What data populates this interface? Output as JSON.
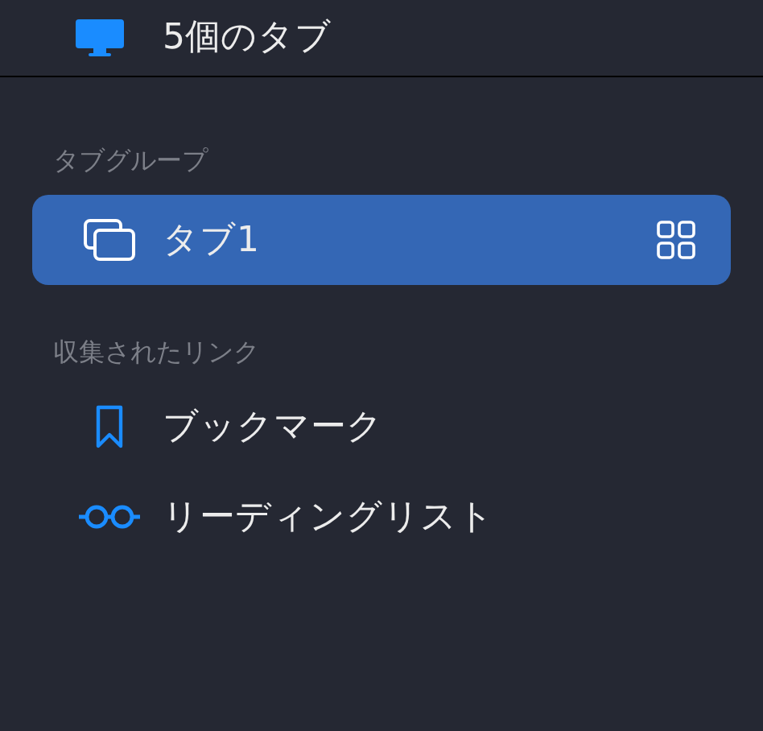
{
  "top_item": {
    "label": "5個のタブ",
    "kind": "device"
  },
  "sections": [
    {
      "header": "タブグループ",
      "items": [
        {
          "label": "タブ1",
          "kind": "tab-group",
          "selected": true,
          "overview_button": true
        }
      ]
    },
    {
      "header": "収集されたリンク",
      "items": [
        {
          "label": "ブックマーク",
          "kind": "bookmark",
          "selected": false,
          "overview_button": false
        },
        {
          "label": "リーディングリスト",
          "kind": "reading-list",
          "selected": false,
          "overview_button": false
        }
      ]
    }
  ]
}
